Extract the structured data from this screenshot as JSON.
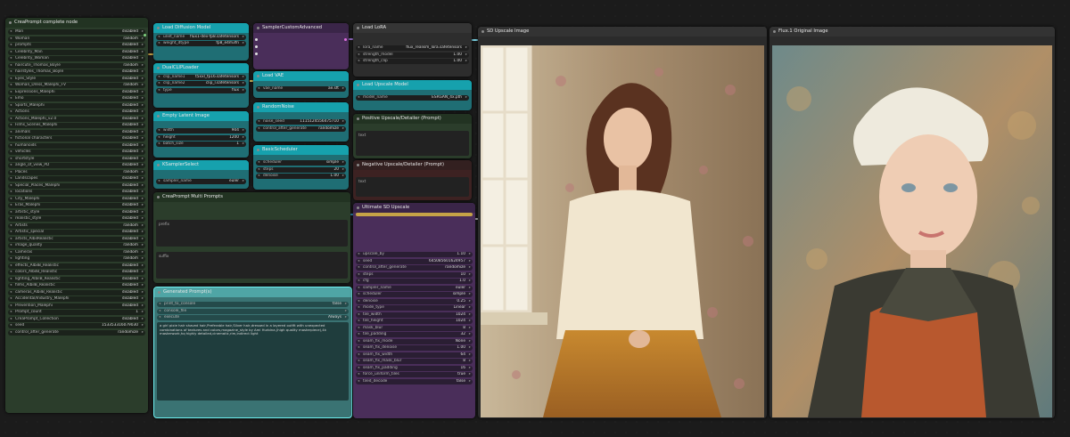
{
  "nodes": {
    "crea_complete": {
      "title": "CreaPrompt complete node",
      "rows": [
        {
          "label": "Man",
          "value": "disabled"
        },
        {
          "label": "Woman",
          "value": "random"
        },
        {
          "label": "prompts",
          "value": "disabled"
        },
        {
          "label": "Celebrity_Man",
          "value": "disabled"
        },
        {
          "label": "Celebrity_Woman",
          "value": "disabled"
        },
        {
          "label": "haircute_Thomas_Boyle",
          "value": "random"
        },
        {
          "label": "hairstyles_Thomas_Boyle",
          "value": "disabled"
        },
        {
          "label": "Eyes_Style",
          "value": "disabled"
        },
        {
          "label": "Woman_Dress_Malephi_FV",
          "value": "random"
        },
        {
          "label": "Expressions_Malephi",
          "value": "disabled"
        },
        {
          "label": "Emo",
          "value": "disabled"
        },
        {
          "label": "Sports_Malephi",
          "value": "disabled"
        },
        {
          "label": "Actions",
          "value": "disabled"
        },
        {
          "label": "Actions_Malephi_v2.0",
          "value": "disabled"
        },
        {
          "label": "Films_Scenes_Malephi",
          "value": "disabled"
        },
        {
          "label": "animals",
          "value": "disabled"
        },
        {
          "label": "fictional characters",
          "value": "disabled"
        },
        {
          "label": "humanoids",
          "value": "disabled"
        },
        {
          "label": "vehicles",
          "value": "disabled"
        },
        {
          "label": "shortstyle",
          "value": "disabled"
        },
        {
          "label": "angle_of_view_PD",
          "value": "disabled"
        },
        {
          "label": "Places",
          "value": "random"
        },
        {
          "label": "Landscapes",
          "value": "disabled"
        },
        {
          "label": "Special_Places_Malephi",
          "value": "disabled"
        },
        {
          "label": "locations",
          "value": "disabled"
        },
        {
          "label": "City_Malephi",
          "value": "disabled"
        },
        {
          "label": "Eras_Malephi",
          "value": "disabled"
        },
        {
          "label": "artistic_style",
          "value": "disabled"
        },
        {
          "label": "realistic_style",
          "value": "disabled"
        },
        {
          "label": "Artists",
          "value": "random"
        },
        {
          "label": "Artistic_special",
          "value": "disabled"
        },
        {
          "label": "artists_AlbilRealistic",
          "value": "disabled"
        },
        {
          "label": "image_quality",
          "value": "random"
        },
        {
          "label": "Cameras",
          "value": "random"
        },
        {
          "label": "lighting",
          "value": "random"
        },
        {
          "label": "effects_AlbilB_Realistic",
          "value": "disabled"
        },
        {
          "label": "colors_AlbilB_Realistic",
          "value": "disabled"
        },
        {
          "label": "lighting_AlbilB_Realistic",
          "value": "disabled"
        },
        {
          "label": "films_AlbilB_Realistic",
          "value": "disabled"
        },
        {
          "label": "cameras_AlbilB_Realistic",
          "value": "disabled"
        },
        {
          "label": "Accidental/Industry_Malephi",
          "value": "disabled"
        },
        {
          "label": "Prevention_Malephi",
          "value": "disabled"
        },
        {
          "label": "Prompt_count",
          "value": "1"
        },
        {
          "label": "CreaPrompt_Collection",
          "value": "disabled"
        },
        {
          "label": "seed",
          "value": "153353316079030"
        },
        {
          "label": "control_after_generate",
          "value": "randomize"
        }
      ]
    },
    "load_diffusion": {
      "title": "Load Diffusion Model",
      "rows": [
        {
          "label": "unet_name",
          "value": "flux1-dev-fp8.safetensors"
        },
        {
          "label": "weight_dtype",
          "value": "fp8_e4m3fn"
        }
      ]
    },
    "dualclip": {
      "title": "DualCLIPLoader",
      "rows": [
        {
          "label": "clip_name1",
          "value": "t5xxl_fp16.safetensors"
        },
        {
          "label": "clip_name2",
          "value": "clip_l.safetensors"
        },
        {
          "label": "type",
          "value": "flux"
        }
      ]
    },
    "empty_latent": {
      "title": "Empty Latent Image",
      "rows": [
        {
          "label": "width",
          "value": "904"
        },
        {
          "label": "height",
          "value": "1200"
        },
        {
          "label": "batch_size",
          "value": "1"
        }
      ]
    },
    "ksampler_select": {
      "title": "KSamplerSelect",
      "rows": [
        {
          "label": "sampler_name",
          "value": "euler"
        }
      ]
    },
    "sampler_custom": {
      "title": "SamplerCustomAdvanced"
    },
    "load_vae": {
      "title": "Load VAE",
      "rows": [
        {
          "label": "vae_name",
          "value": "ae.sft"
        }
      ]
    },
    "random_noise": {
      "title": "RandomNoise",
      "rows": [
        {
          "label": "noise_seed",
          "value": "1115124556475710"
        },
        {
          "label": "control_after_generate",
          "value": "randomize"
        }
      ]
    },
    "basic_scheduler": {
      "title": "BasicScheduler",
      "rows": [
        {
          "label": "scheduler",
          "value": "simple"
        },
        {
          "label": "steps",
          "value": "20"
        },
        {
          "label": "denoise",
          "value": "1.00"
        }
      ]
    },
    "load_lora": {
      "title": "Load LoRA",
      "rows": [
        {
          "label": "lora_name",
          "value": "flux_realism_lora.safetensors"
        },
        {
          "label": "strength_model",
          "value": "1.00"
        },
        {
          "label": "strength_clip",
          "value": "1.00"
        }
      ]
    },
    "load_upscale": {
      "title": "Load Upscale Model",
      "rows": [
        {
          "label": "model_name",
          "value": "ESRGAN_4x.pth"
        }
      ]
    },
    "positive": {
      "title": "Positive Upscale/Detailer (Prompt)",
      "text": "text"
    },
    "negative": {
      "title": "Negative Upscale/Detailer (Prompt)",
      "text": "text"
    },
    "multi_prompts": {
      "title": "CreaPrompt Multi Prompts",
      "prefix": "prefix",
      "suffix": "suffix"
    },
    "generated": {
      "title": "Generated Prompt(s)",
      "rows": [
        {
          "label": "print_to_console",
          "value": "false"
        },
        {
          "label": "console_file",
          "value": ""
        },
        {
          "label": "execute",
          "value": "Always"
        }
      ],
      "text": "a girl pixie hair shaved hair,Preferable hair,Silver hair,dressed in a layered outfit with unexpected combinations of textures and colors,magazine_style by Ami Hurbina,(high quality masterpiece),4k masterwork,hq highly detailed,cinematic,rim,indirect light"
    },
    "ultimate_sd": {
      "title": "Ultimate SD Upscale",
      "rows": [
        {
          "label": "upscale_by",
          "value": "1.10"
        },
        {
          "label": "seed",
          "value": "645085601624957"
        },
        {
          "label": "control_after_generate",
          "value": "randomize"
        },
        {
          "label": "steps",
          "value": "10"
        },
        {
          "label": "cfg",
          "value": "1.0"
        },
        {
          "label": "sampler_name",
          "value": "euler"
        },
        {
          "label": "scheduler",
          "value": "simple"
        },
        {
          "label": "denoise",
          "value": "0.25"
        },
        {
          "label": "mode_type",
          "value": "Linear"
        },
        {
          "label": "tile_width",
          "value": "1024"
        },
        {
          "label": "tile_height",
          "value": "1024"
        },
        {
          "label": "mask_blur",
          "value": "8"
        },
        {
          "label": "tile_padding",
          "value": "32"
        },
        {
          "label": "seam_fix_mode",
          "value": "None"
        },
        {
          "label": "seam_fix_denoise",
          "value": "1.00"
        },
        {
          "label": "seam_fix_width",
          "value": "64"
        },
        {
          "label": "seam_fix_mask_blur",
          "value": "8"
        },
        {
          "label": "seam_fix_padding",
          "value": "16"
        },
        {
          "label": "force_uniform_tiles",
          "value": "true"
        },
        {
          "label": "tiled_decode",
          "value": "false"
        }
      ]
    },
    "sd_upscale_image": {
      "title": "SD Upscale Image"
    },
    "flux_original": {
      "title": "Flux.1 Original Image"
    }
  }
}
